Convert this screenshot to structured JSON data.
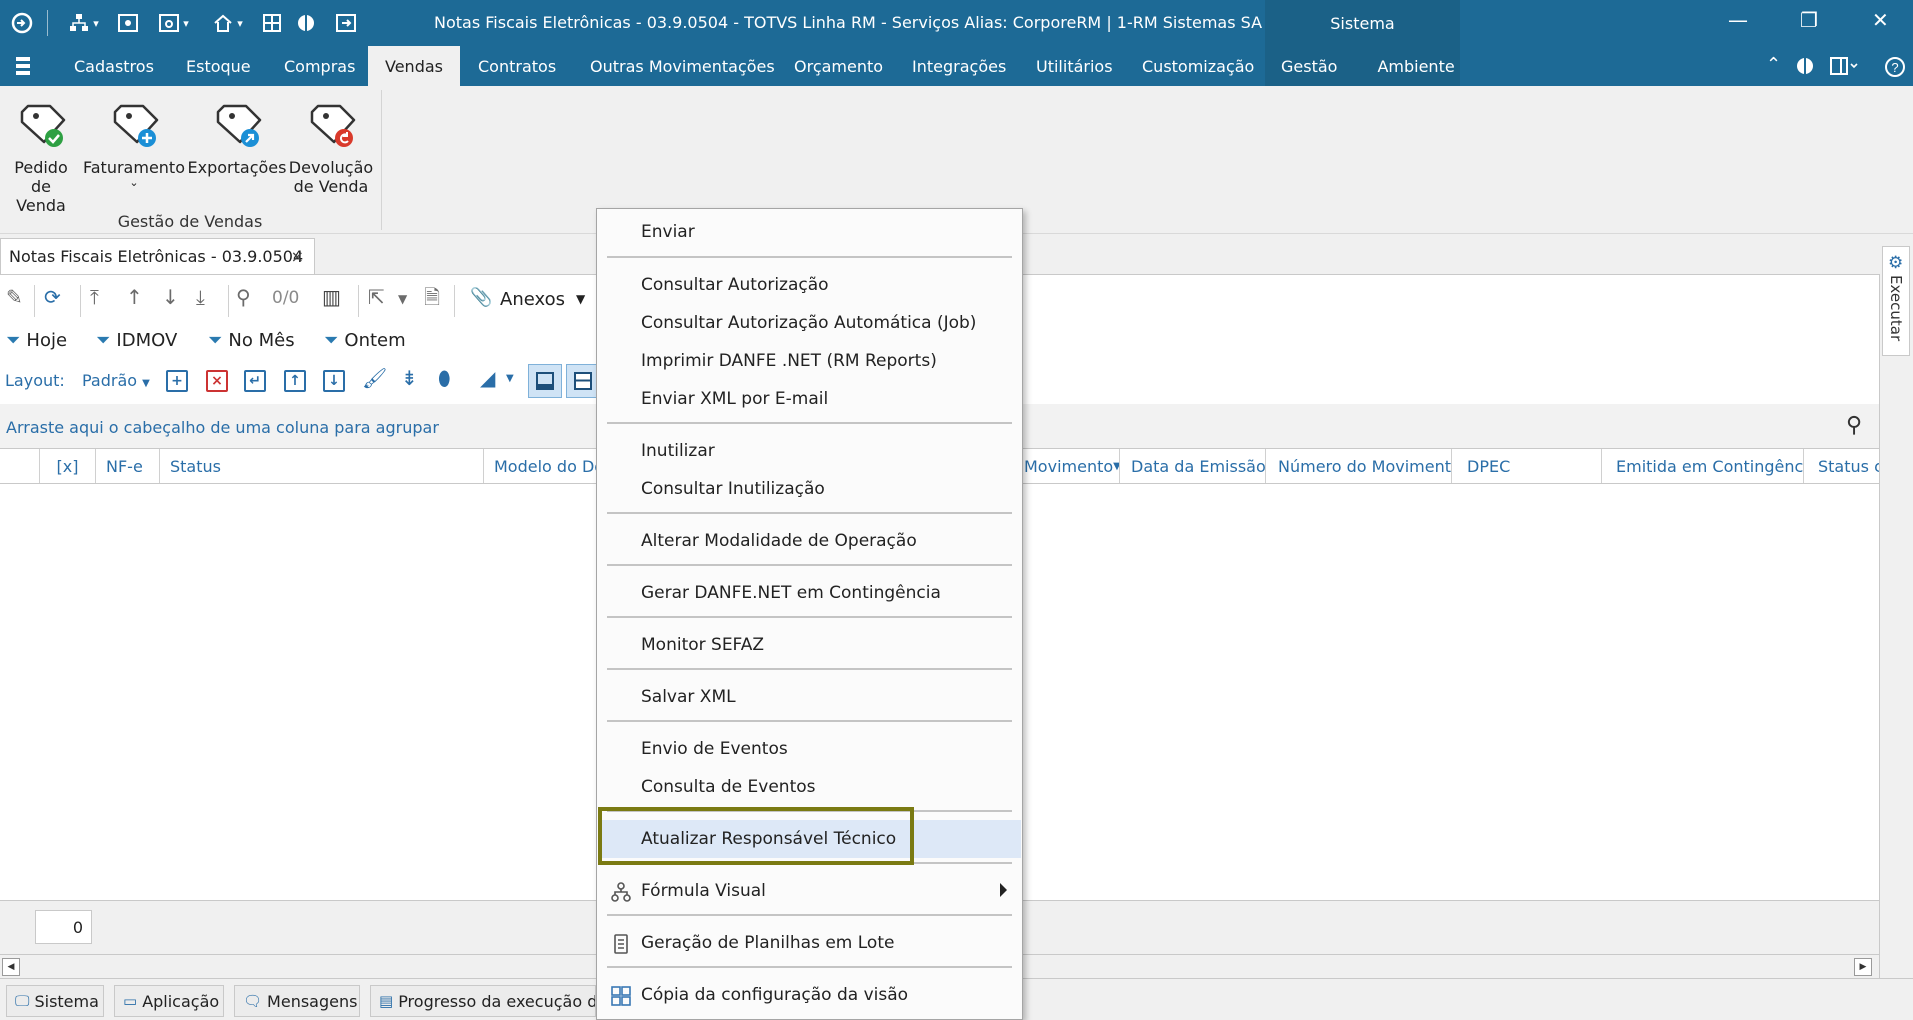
{
  "window": {
    "title": "Notas Fiscais Eletrônicas - 03.9.0504 - TOTVS Linha RM - Serviços  Alias: CorporeRM | 1-RM Sistemas SA",
    "sistema_tab": "Sistema",
    "controls": {
      "minimize": "—",
      "restore": "❐",
      "close": "✕"
    }
  },
  "menubar": {
    "items": [
      "Cadastros",
      "Estoque",
      "Compras",
      "Vendas",
      "Contratos",
      "Outras Movimentações",
      "Orçamento",
      "Integrações",
      "Utilitários",
      "Customização",
      "Gestão",
      "Ambiente"
    ],
    "active": "Vendas"
  },
  "ribbon": {
    "buttons": [
      {
        "label": "Pedido\nde Venda",
        "icon": "tag-check-icon",
        "accent": "#2ea043"
      },
      {
        "label": "Faturamento",
        "icon": "tag-plus-icon",
        "accent": "#1b8fd6",
        "has_dropdown": true
      },
      {
        "label": "Exportações",
        "icon": "tag-export-icon",
        "accent": "#1b8fd6"
      },
      {
        "label": "Devolução\nde Venda",
        "icon": "tag-return-icon",
        "accent": "#d93a2b"
      }
    ],
    "group_label": "Gestão de Vendas"
  },
  "doc_tab": {
    "title": "Notas Fiscais Eletrônicas - 03.9.0504",
    "close": "×"
  },
  "toolbar": {
    "counter": "0/0",
    "anexos_label": "Anexos"
  },
  "filters": [
    "Hoje",
    "IDMOV",
    "No Mês",
    "Ontem"
  ],
  "layout_bar": {
    "label": "Layout:",
    "value": "Padrão"
  },
  "group_panel": {
    "hint": "Arraste aqui o cabeçalho de uma coluna para agrupar"
  },
  "grid": {
    "columns": [
      "[x]",
      "NF-e",
      "Status",
      "Modelo do Do",
      "Movimento",
      "Data da Emissão",
      "Número do Movimento",
      "DPEC",
      "Emitida em Contingência",
      "Status c"
    ],
    "record_count": "0"
  },
  "side_panel": {
    "label": "Executar"
  },
  "statusbar": {
    "tabs": [
      "Sistema",
      "Aplicação",
      "Mensagens",
      "Progresso da execução do"
    ]
  },
  "context_menu": {
    "items": [
      "Enviar",
      "Consultar Autorização",
      "Consultar Autorização Automática (Job)",
      "Imprimir DANFE .NET (RM Reports)",
      "Enviar XML por E-mail",
      "Inutilizar",
      "Consultar Inutilização",
      "Alterar Modalidade de Operação",
      "Gerar DANFE.NET em Contingência",
      "Monitor SEFAZ",
      "Salvar XML",
      "Envio de Eventos",
      "Consulta de Eventos",
      "Atualizar Responsável Técnico",
      "Fórmula Visual",
      "Geração de Planilhas em Lote",
      "Cópia da configuração da visão"
    ],
    "highlighted": "Atualizar Responsável Técnico",
    "highlight_border_color": "#7a7a12",
    "submenu_item": "Fórmula Visual"
  },
  "colors": {
    "titlebar": "#1d6a96",
    "accent_blue": "#2a6ea8",
    "menu_highlight": "#dde8f7"
  }
}
